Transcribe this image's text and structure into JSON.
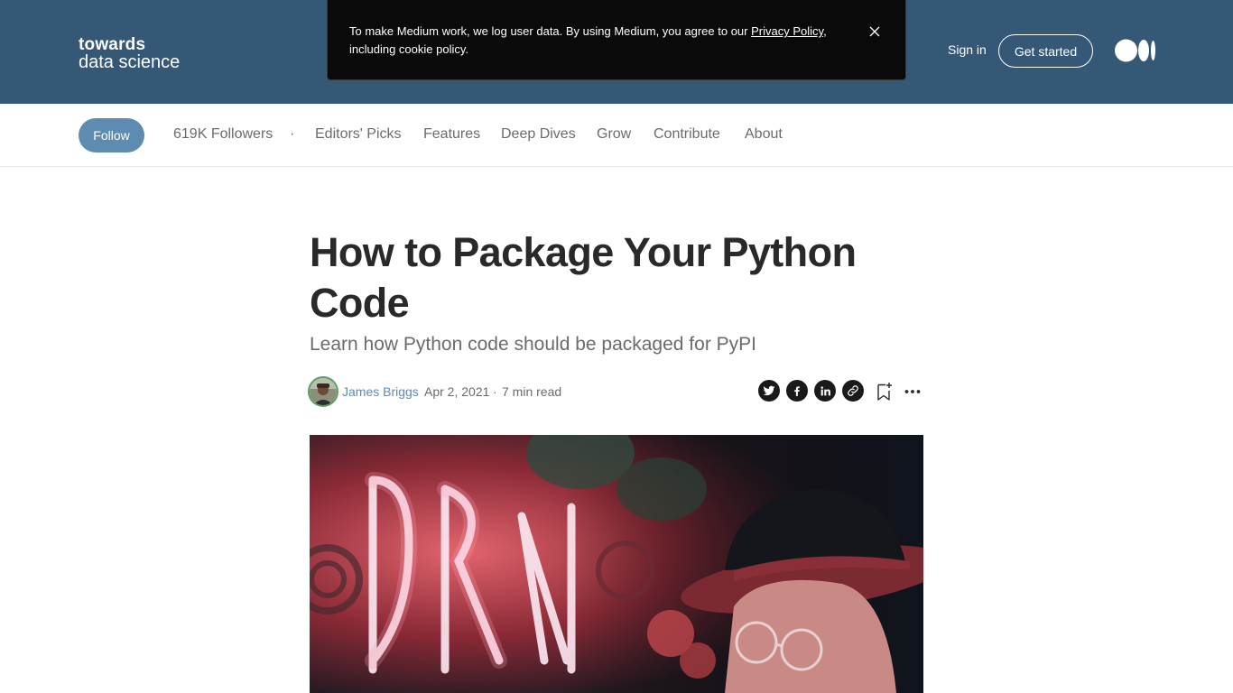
{
  "header": {
    "logo_line1": "towards",
    "logo_line2": "data science",
    "signin_label": "Sign in",
    "get_started_label": "Get started"
  },
  "cookie_banner": {
    "text_before": "To make Medium work, we log user data. By using Medium, you agree to our ",
    "link_text": "Privacy Policy",
    "text_after": ", including cookie policy."
  },
  "nav": {
    "follow_label": "Follow",
    "followers": "619K Followers",
    "separator": "·",
    "items": [
      {
        "label": "Editors' Picks"
      },
      {
        "label": "Features"
      },
      {
        "label": "Deep Dives"
      },
      {
        "label": "Grow"
      },
      {
        "label": "Contribute"
      },
      {
        "label": "About"
      }
    ]
  },
  "article": {
    "title": "How to Package Your Python Code",
    "subtitle": "Learn how Python code should be packaged for PyPI",
    "author": "James Briggs",
    "date": "Apr 2, 2021",
    "separator": "·",
    "read_time": "7 min read"
  },
  "share_icons": [
    "twitter-icon",
    "facebook-icon",
    "linkedin-icon",
    "link-icon"
  ],
  "colors": {
    "header_bg": "#355876",
    "follow_bg": "#5e8bb1",
    "author_link": "#5e8bb1",
    "cookie_bg": "#0a0a0a",
    "text_primary": "#292929",
    "text_secondary": "#6b6b6b"
  }
}
